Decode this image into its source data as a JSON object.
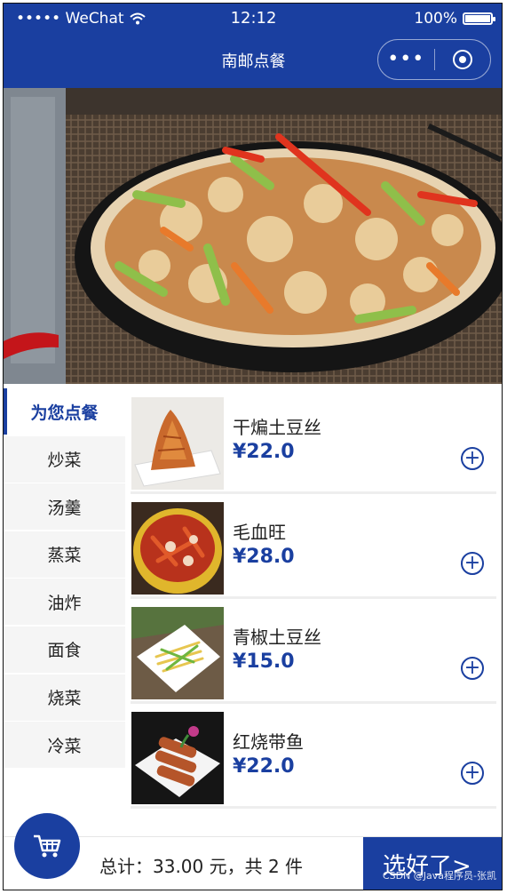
{
  "status_bar": {
    "carrier": "••••• WeChat",
    "time": "12:12",
    "battery": "100%"
  },
  "nav": {
    "title": "南邮点餐",
    "more_label": "•••"
  },
  "categories": [
    "为您点餐",
    "炒菜",
    "汤羹",
    "蒸菜",
    "油炸",
    "面食",
    "烧菜",
    "冷菜"
  ],
  "foods": [
    {
      "name": "干煸土豆丝",
      "price": "¥22.0"
    },
    {
      "name": "毛血旺",
      "price": "¥28.0"
    },
    {
      "name": "青椒土豆丝",
      "price": "¥15.0"
    },
    {
      "name": "红烧带鱼",
      "price": "¥22.0"
    }
  ],
  "cart": {
    "total_text": "总计：33.00 元，共 2 件",
    "confirm_label": "选好了>"
  },
  "watermark": "CSDN @Java程序员-张凯",
  "colors": {
    "brand": "#1a3fa0",
    "sidebar_bg": "#f5f5f5"
  },
  "icons": {
    "add": "plus-circle-icon",
    "cart": "cart-icon"
  }
}
